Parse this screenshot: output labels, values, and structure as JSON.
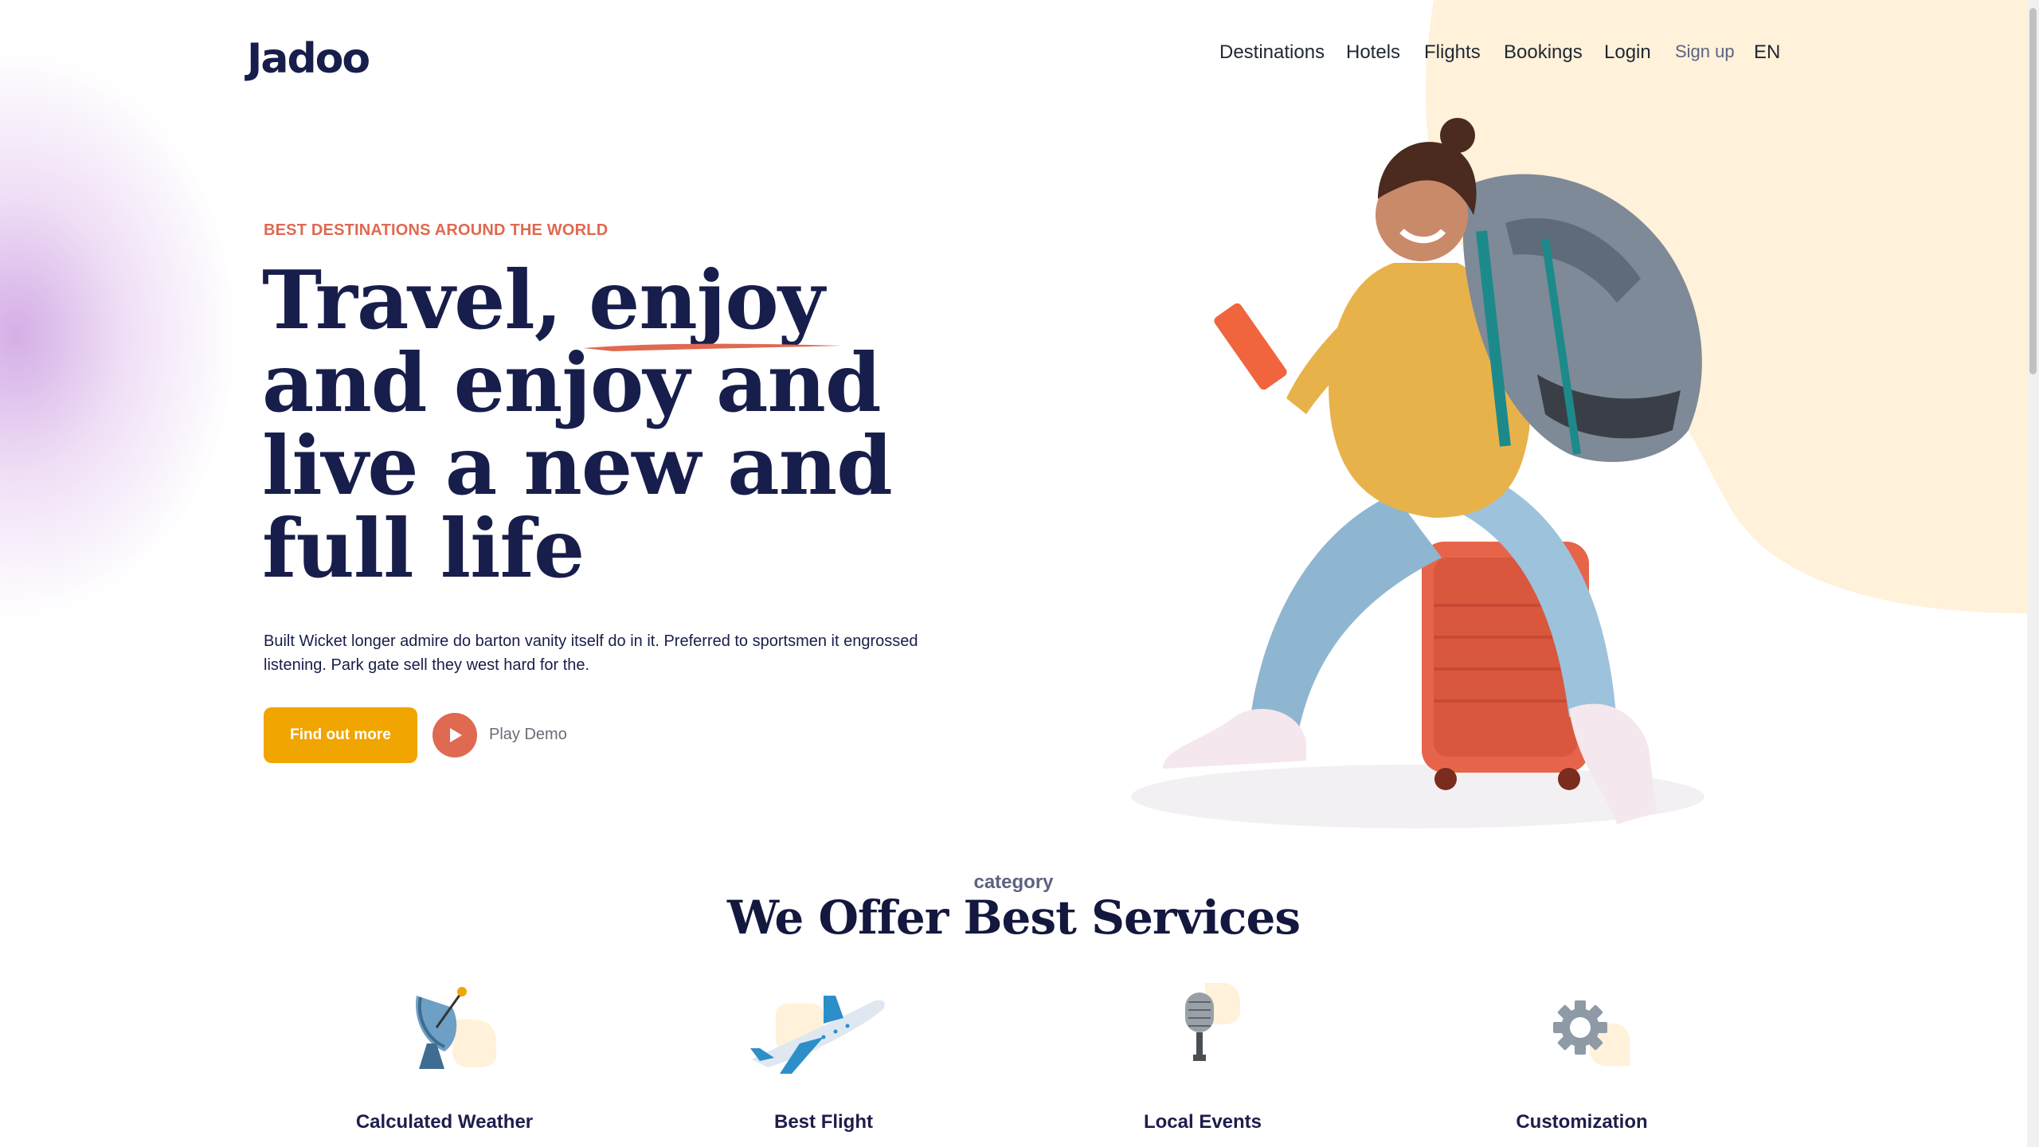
{
  "brand": {
    "logo_text": "Jadoo"
  },
  "nav": {
    "items": [
      {
        "label": "Destinations"
      },
      {
        "label": "Hotels"
      },
      {
        "label": "Flights"
      },
      {
        "label": "Bookings"
      },
      {
        "label": "Login"
      },
      {
        "label": "Sign up"
      },
      {
        "label": "EN"
      }
    ]
  },
  "hero": {
    "eyebrow": "BEST DESTINATIONS AROUND THE WORLD",
    "headline_lines": [
      "Travel, enjoy",
      "and enjoy and",
      "live a new and",
      "full life"
    ],
    "description": "Built Wicket longer admire do barton vanity itself do in it. Preferred to sportsmen it engrossed listening. Park gate sell they west hard for the.",
    "cta_label": "Find out more",
    "play_label": "Play Demo"
  },
  "services": {
    "eyebrow": "category",
    "title": "We Offer Best Services",
    "items": [
      {
        "label": "Calculated Weather",
        "icon": "satellite-dish-icon"
      },
      {
        "label": "Best Flight",
        "icon": "airplane-icon"
      },
      {
        "label": "Local Events",
        "icon": "microphone-icon"
      },
      {
        "label": "Customization",
        "icon": "gear-icon"
      }
    ]
  },
  "colors": {
    "accent": "#f1a501",
    "coral": "#df6951",
    "navy": "#181e4b",
    "cream": "#fff1da"
  }
}
